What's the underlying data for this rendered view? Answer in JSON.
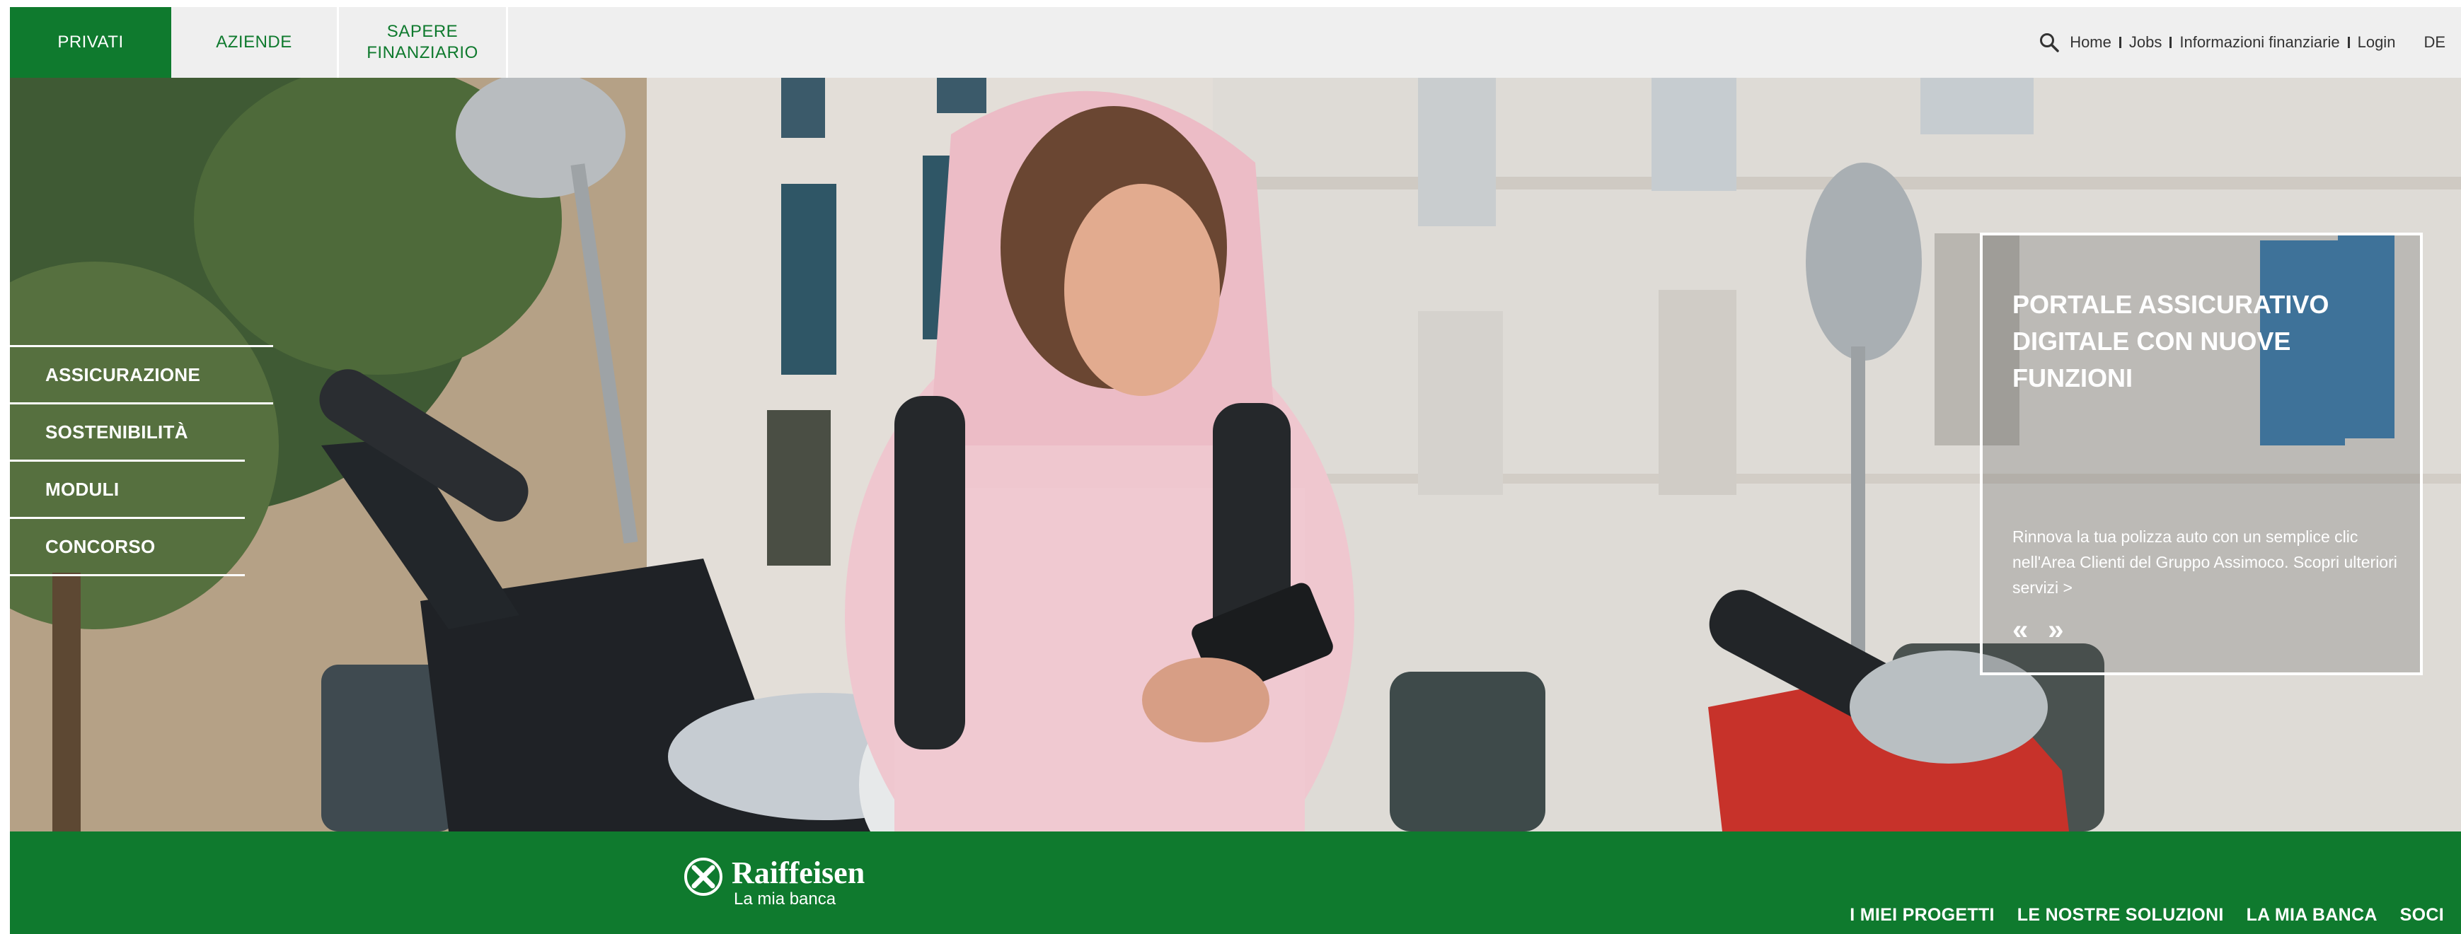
{
  "topbar": {
    "tabs": [
      {
        "label": "PRIVATI",
        "active": true
      },
      {
        "label": "AZIENDE",
        "active": false
      },
      {
        "label": "SAPERE\nFINANZIARIO",
        "active": false
      }
    ],
    "utility_links": [
      "Home",
      "Jobs",
      "Informazioni finanziarie",
      "Login"
    ],
    "language": "DE",
    "search_icon": "search-icon"
  },
  "hero": {
    "side_menu": [
      "ASSICURAZIONE",
      "SOSTENIBILITÀ",
      "MODULI",
      "CONCORSO"
    ],
    "promo": {
      "title": "PORTALE ASSICURATIVO DIGITALE CON NUOVE FUNZIONI",
      "text": "Rinnova la tua polizza auto con un semplice clic nell'Area Clienti del Gruppo Assimoco. Scopri ulteriori servizi >",
      "prev": "«",
      "next": "»"
    }
  },
  "footer": {
    "brand": "Raiffeisen",
    "tagline": "La mia banca",
    "nav": [
      "I MIEI PROGETTI",
      "LE NOSTRE SOLUZIONI",
      "LA MIA BANCA",
      "SOCI"
    ]
  },
  "colors": {
    "brand_green": "#0f7a2e",
    "topbar_bg": "#efefef",
    "white": "#ffffff"
  }
}
